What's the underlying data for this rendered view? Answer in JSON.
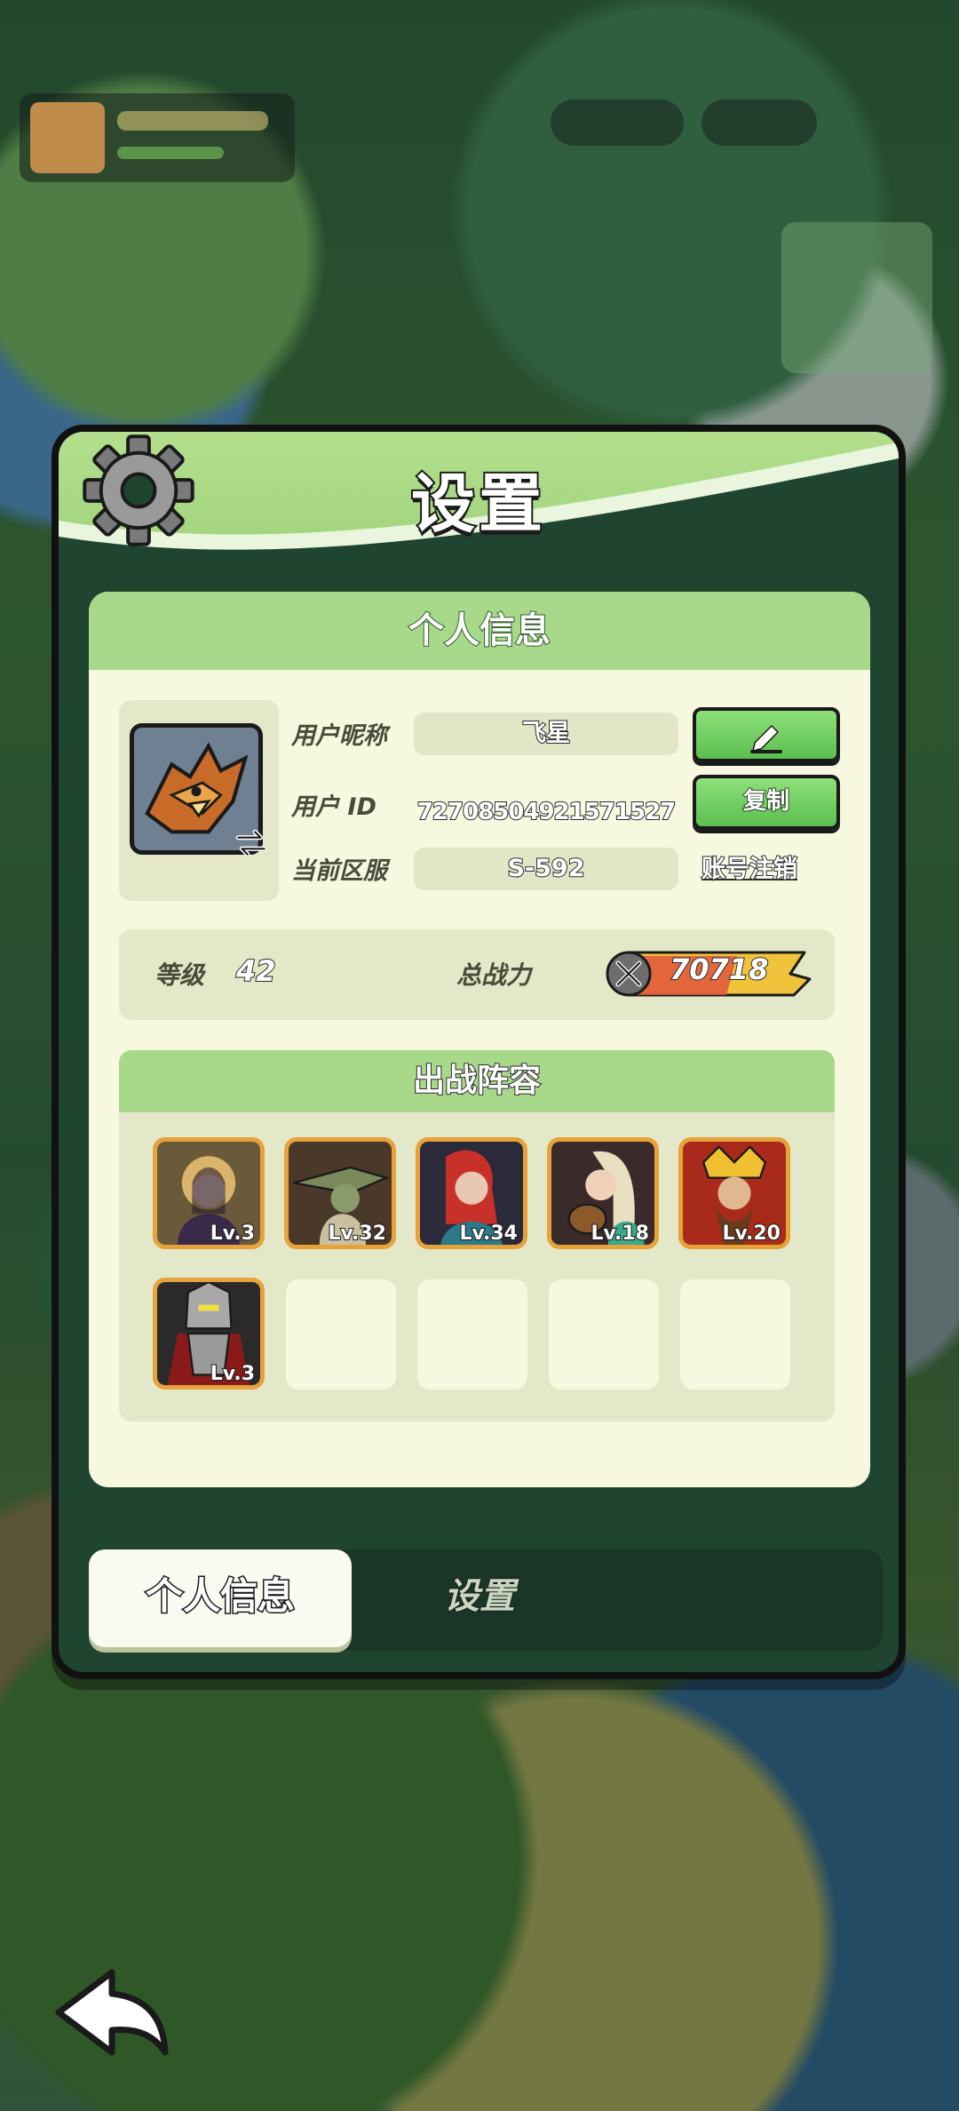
{
  "panel": {
    "title": "设置",
    "section_title": "个人信息"
  },
  "profile": {
    "nickname_label": "用户昵称",
    "nickname": "飞星",
    "uid_label": "用户 ID",
    "uid": "72708504921571527",
    "server_label": "当前区服",
    "server": "S-592",
    "edit_icon": "pencil-icon",
    "copy_label": "复制",
    "cancel_account_label": "账号注销"
  },
  "stats": {
    "level_label": "等级",
    "level": "42",
    "power_label": "总战力",
    "power": "70718"
  },
  "lineup": {
    "title": "出战阵容",
    "heroes": [
      {
        "level": "Lv.3"
      },
      {
        "level": "Lv.32"
      },
      {
        "level": "Lv.34"
      },
      {
        "level": "Lv.18"
      },
      {
        "level": "Lv.20"
      },
      {
        "level": "Lv.3"
      }
    ],
    "empty_slots": 4
  },
  "tabs": [
    {
      "label": "个人信息",
      "active": true
    },
    {
      "label": "设置",
      "active": false
    }
  ],
  "colors": {
    "header_green": "#a8d88a",
    "button_green": "#5bbf4f",
    "card_bg": "#f6f8df",
    "panel_bg": "#1f4430",
    "hero_border": "#e7a23a"
  }
}
